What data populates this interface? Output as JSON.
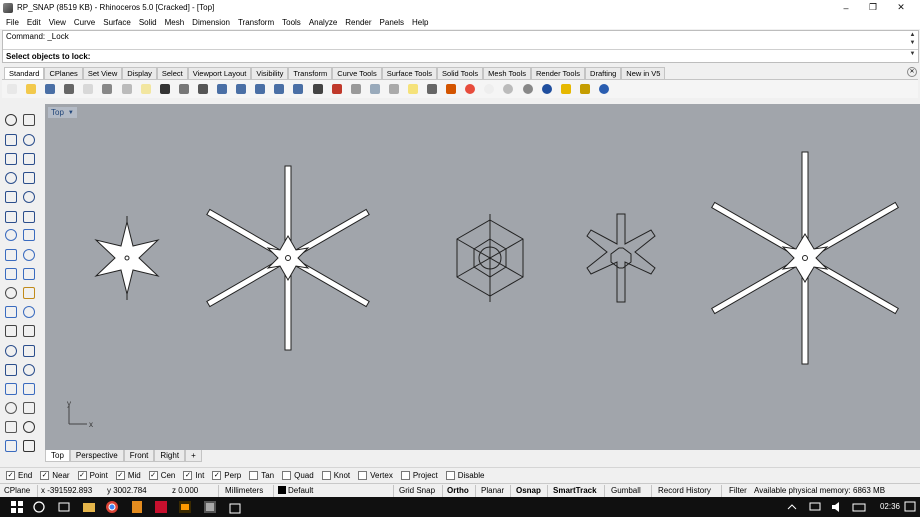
{
  "window": {
    "title": "RP_SNAP (8519 KB) - Rhinoceros 5.0 [Cracked] - [Top]",
    "controls": [
      "–",
      "❐",
      "✕"
    ]
  },
  "menu": [
    "File",
    "Edit",
    "View",
    "Curve",
    "Surface",
    "Solid",
    "Mesh",
    "Dimension",
    "Transform",
    "Tools",
    "Analyze",
    "Render",
    "Panels",
    "Help"
  ],
  "command": {
    "history": "Command: _Lock",
    "prompt": "Select objects to lock:",
    "value": ""
  },
  "toolbar_tabs": [
    "Standard",
    "CPlanes",
    "Set View",
    "Display",
    "Select",
    "Viewport Layout",
    "Visibility",
    "Transform",
    "Curve Tools",
    "Surface Tools",
    "Solid Tools",
    "Mesh Tools",
    "Render Tools",
    "Drafting",
    "New in V5"
  ],
  "toolbar_icons": [
    "new-file-icon",
    "open-file-icon",
    "save-icon",
    "print-icon",
    "import-icon",
    "cut-icon",
    "copy-icon",
    "paste-icon",
    "undo-icon",
    "pan-icon",
    "rotate-view-icon",
    "zoom-window-icon",
    "zoom-dynamic-icon",
    "zoom-extents-icon",
    "zoom-selected-icon",
    "zoom-target-icon",
    "grid-icon",
    "car-icon",
    "camera-icon",
    "cplane-icon",
    "point-icon",
    "lightbulb-icon",
    "lock-icon",
    "object-properties-icon",
    "color-wheel-icon",
    "render-sphere-icon",
    "material-sphere-icon",
    "environment-sphere-icon",
    "blue-sphere-icon",
    "light-icon",
    "gear-settings-icon",
    "help-icon"
  ],
  "viewport": {
    "label": "Top",
    "axis_y": "y",
    "axis_x": "x"
  },
  "view_tabs": [
    "Top",
    "Perspective",
    "Front",
    "Right",
    "+"
  ],
  "osnap": [
    {
      "label": "End",
      "checked": true
    },
    {
      "label": "Near",
      "checked": true
    },
    {
      "label": "Point",
      "checked": true
    },
    {
      "label": "Mid",
      "checked": true
    },
    {
      "label": "Cen",
      "checked": true
    },
    {
      "label": "Int",
      "checked": true
    },
    {
      "label": "Perp",
      "checked": true
    },
    {
      "label": "Tan",
      "checked": false
    },
    {
      "label": "Quad",
      "checked": false
    },
    {
      "label": "Knot",
      "checked": false
    },
    {
      "label": "Vertex",
      "checked": false
    },
    {
      "label": "Project",
      "checked": false
    },
    {
      "label": "Disable",
      "checked": false
    }
  ],
  "status": {
    "cplane": "CPlane",
    "x": "x -391592.893",
    "y": "y 3002.784",
    "z": "z 0.000",
    "units": "Millimeters",
    "layer": "Default",
    "grid_snap": "Grid Snap",
    "ortho": "Ortho",
    "planar": "Planar",
    "osnap": "Osnap",
    "smarttrack": "SmartTrack",
    "gumball": "Gumball",
    "record_history": "Record History",
    "filter": "Filter",
    "memory": "Available physical memory: 6863 MB"
  },
  "taskbar": {
    "clock": "02:36"
  },
  "colors": {
    "viewport_bg": "#a1a5ab",
    "taskbar_bg": "#101010"
  }
}
